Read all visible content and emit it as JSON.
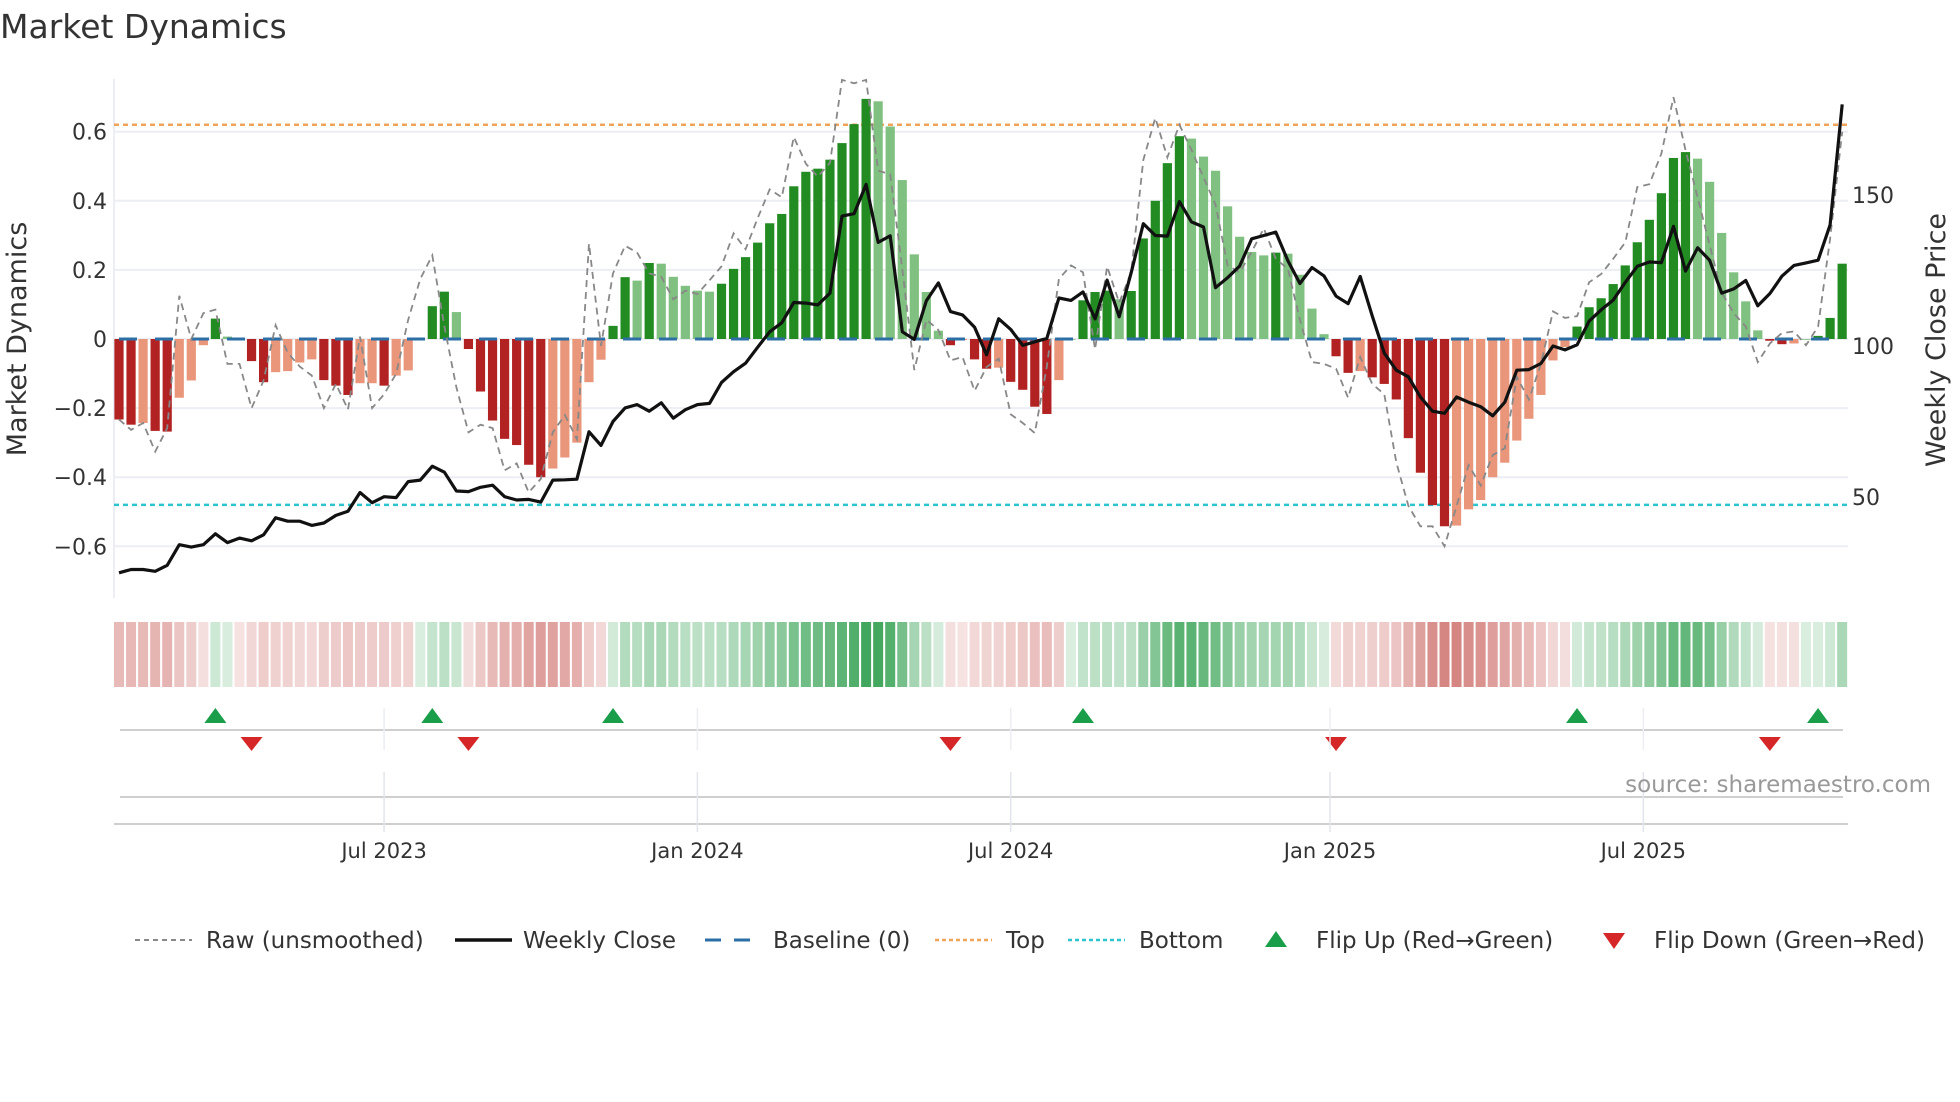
{
  "title": "Market Dynamics",
  "source": "source: sharemaestro.com",
  "colors": {
    "strong_up": "#228b22",
    "weak_up": "#80c080",
    "strong_down": "#b22222",
    "weak_down": "#e9967a",
    "close": "#111111",
    "raw": "#888888",
    "baseline": "#2b6fa6",
    "top": "#f0a45a",
    "bottom": "#2ec4cf",
    "flip_up": "#1a9e4a",
    "flip_down": "#d62728"
  },
  "legend": [
    {
      "label": "Raw (unsmoothed)",
      "kind": "raw"
    },
    {
      "label": "Weekly Close",
      "kind": "close"
    },
    {
      "label": "Baseline (0)",
      "kind": "baseline"
    },
    {
      "label": "Top",
      "kind": "top"
    },
    {
      "label": "Bottom",
      "kind": "bottom"
    },
    {
      "label": "Flip Up (Red→Green)",
      "kind": "flip_up"
    },
    {
      "label": "Flip Down (Green→Red)",
      "kind": "flip_down"
    }
  ],
  "chart_data": {
    "type": "bar",
    "title": "Market Dynamics",
    "ylabel": "Market Dynamics",
    "y2label": "Weekly Close Price",
    "ylim": [
      -0.7,
      0.75
    ],
    "yticks": [
      0.6,
      0.4,
      0.2,
      0,
      -0.2,
      -0.4,
      -0.6
    ],
    "ytick_labels": [
      "0.6",
      "0.4",
      "0.2",
      "0",
      "−0.2",
      "−0.4",
      "−0.6"
    ],
    "y2ticks": [
      150,
      100,
      50
    ],
    "y2tick_labels": [
      "150",
      "100",
      "50"
    ],
    "xtick_labels": [
      "Jul 2023",
      "Jan 2024",
      "Jul 2024",
      "Jan 2025",
      "Jul 2025"
    ],
    "xtick_week_index": [
      22,
      48,
      74,
      100.5,
      126.5
    ],
    "grid": true,
    "legend_position": "bottom",
    "top_level": 0.62,
    "bottom_level": -0.48,
    "baseline": 0,
    "values": [
      -0.233,
      -0.248,
      -0.243,
      -0.266,
      -0.268,
      -0.17,
      -0.12,
      -0.018,
      0.059,
      0.007,
      -0.002,
      -0.064,
      -0.125,
      -0.096,
      -0.093,
      -0.068,
      -0.059,
      -0.119,
      -0.135,
      -0.162,
      -0.128,
      -0.128,
      -0.135,
      -0.106,
      -0.091,
      0,
      0.095,
      0.137,
      0.078,
      -0.029,
      -0.152,
      -0.236,
      -0.289,
      -0.307,
      -0.364,
      -0.4,
      -0.375,
      -0.343,
      -0.3,
      -0.125,
      -0.06,
      0.038,
      0.179,
      0.169,
      0.22,
      0.218,
      0.18,
      0.154,
      0.14,
      0.137,
      0.16,
      0.203,
      0.237,
      0.279,
      0.335,
      0.362,
      0.442,
      0.484,
      0.493,
      0.519,
      0.567,
      0.622,
      0.695,
      0.688,
      0.615,
      0.46,
      0.245,
      0.136,
      0.024,
      -0.018,
      -0.003,
      -0.059,
      -0.086,
      -0.083,
      -0.124,
      -0.147,
      -0.196,
      -0.217,
      -0.119,
      0,
      0.112,
      0.136,
      0.14,
      0.115,
      0.139,
      0.291,
      0.4,
      0.509,
      0.587,
      0.58,
      0.528,
      0.487,
      0.384,
      0.296,
      0.252,
      0.242,
      0.25,
      0.247,
      0.186,
      0.088,
      0.014,
      -0.05,
      -0.098,
      -0.093,
      -0.111,
      -0.13,
      -0.175,
      -0.287,
      -0.387,
      -0.481,
      -0.542,
      -0.54,
      -0.493,
      -0.466,
      -0.4,
      -0.358,
      -0.294,
      -0.231,
      -0.162,
      -0.062,
      -0.023,
      0.036,
      0.092,
      0.118,
      0.159,
      0.213,
      0.28,
      0.345,
      0.422,
      0.524,
      0.541,
      0.522,
      0.455,
      0.307,
      0.193,
      0.109,
      0.025,
      -0.005,
      -0.015,
      -0.013,
      0,
      0.009,
      0.061,
      0.218
    ],
    "strong": [
      1,
      1,
      0,
      1,
      1,
      0,
      0,
      0,
      1,
      0,
      0,
      1,
      1,
      0,
      0,
      0,
      0,
      1,
      1,
      1,
      0,
      0,
      1,
      0,
      0,
      0,
      1,
      1,
      0,
      1,
      1,
      1,
      1,
      1,
      1,
      1,
      0,
      0,
      0,
      0,
      0,
      1,
      1,
      0,
      1,
      0,
      0,
      0,
      0,
      0,
      1,
      1,
      1,
      1,
      1,
      1,
      1,
      1,
      1,
      1,
      1,
      1,
      1,
      0,
      0,
      0,
      0,
      0,
      0,
      1,
      0,
      1,
      1,
      0,
      1,
      1,
      1,
      1,
      0,
      0,
      1,
      1,
      1,
      0,
      1,
      1,
      1,
      1,
      1,
      0,
      0,
      0,
      0,
      0,
      0,
      0,
      1,
      0,
      0,
      0,
      0,
      1,
      1,
      0,
      1,
      1,
      1,
      1,
      1,
      1,
      1,
      0,
      0,
      0,
      0,
      0,
      0,
      0,
      0,
      0,
      0,
      1,
      1,
      1,
      1,
      1,
      1,
      1,
      1,
      1,
      1,
      0,
      0,
      0,
      0,
      0,
      0,
      1,
      1,
      0,
      0,
      1,
      1,
      1
    ],
    "raw": [
      -0.233,
      -0.263,
      -0.243,
      -0.326,
      -0.258,
      0.125,
      0,
      0.075,
      0.085,
      -0.072,
      -0.072,
      -0.2,
      -0.12,
      0.04,
      -0.04,
      -0.08,
      -0.106,
      -0.2,
      -0.13,
      -0.204,
      0.007,
      -0.2,
      -0.16,
      -0.1,
      0.056,
      0.174,
      0.242,
      0.036,
      -0.14,
      -0.27,
      -0.248,
      -0.258,
      -0.38,
      -0.36,
      -0.444,
      -0.405,
      -0.27,
      -0.22,
      -0.29,
      0.276,
      -0.02,
      0.19,
      0.27,
      0.25,
      0.19,
      0.18,
      0.115,
      0.14,
      0.13,
      0.17,
      0.21,
      0.306,
      0.26,
      0.35,
      0.433,
      0.41,
      0.585,
      0.507,
      0.47,
      0.51,
      0.75,
      0.74,
      0.75,
      0.487,
      0.477,
      0.203,
      -0.09,
      0.056,
      0.026,
      -0.062,
      -0.052,
      -0.15,
      -0.081,
      -0.057,
      -0.218,
      -0.243,
      -0.272,
      -0.08,
      0.174,
      0.213,
      0.193,
      -0.03,
      0.21,
      0.105,
      0.193,
      0.518,
      0.64,
      0.526,
      0.62,
      0.547,
      0.468,
      0.389,
      0.213,
      0.193,
      0.252,
      0.32,
      0.232,
      0.203,
      0.056,
      -0.067,
      -0.072,
      -0.086,
      -0.17,
      -0.052,
      -0.13,
      -0.16,
      -0.357,
      -0.483,
      -0.542,
      -0.542,
      -0.6,
      -0.483,
      -0.365,
      -0.424,
      -0.336,
      -0.316,
      -0.11,
      -0.175,
      -0.072,
      0.08,
      0.061,
      0.066,
      0.164,
      0.188,
      0.232,
      0.28,
      0.44,
      0.448,
      0.537,
      0.7,
      0.547,
      0.41,
      0.272,
      0.134,
      0.075,
      0.036,
      -0.067,
      -0.013,
      0.017,
      0.022,
      -0.018,
      0.036,
      0.29,
      0.6
    ],
    "close": [
      24.9,
      26,
      26,
      25.4,
      27.4,
      34.2,
      33.4,
      34.2,
      37.8,
      34.9,
      36.4,
      35.5,
      37.5,
      43.1,
      42,
      42,
      40.6,
      41.4,
      43.9,
      45.3,
      51.5,
      48.1,
      50.1,
      49.8,
      55.1,
      55.6,
      60.2,
      58.2,
      52,
      51.8,
      53.2,
      53.9,
      50.1,
      49,
      49.2,
      48.3,
      55.6,
      55.7,
      55.9,
      71.6,
      67.1,
      75,
      79.5,
      80.6,
      78.4,
      81.2,
      76.1,
      78.9,
      80.6,
      81,
      87.9,
      91.5,
      94.3,
      99.6,
      104.7,
      107.7,
      114.4,
      114.2,
      113.6,
      117.5,
      143,
      143.8,
      153.5,
      134.3,
      136.5,
      104.7,
      102.2,
      115,
      120.9,
      111.4,
      110.3,
      106.2,
      97.1,
      109,
      105.5,
      100.2,
      101.4,
      102.5,
      115.9,
      115.1,
      117.9,
      109,
      121.8,
      109.7,
      124.3,
      140.5,
      136.6,
      136.4,
      147.8,
      141.1,
      139.4,
      119.3,
      122.6,
      126.5,
      135.5,
      136.6,
      137.7,
      128.2,
      120.7,
      126,
      123.2,
      116.5,
      114,
      123,
      110,
      97.6,
      92,
      89.8,
      83.1,
      78.4,
      77.7,
      83.1,
      81.4,
      79.9,
      76.9,
      81.4,
      92,
      92.2,
      94.2,
      100,
      98.7,
      100.4,
      108.2,
      112,
      115.2,
      121.1,
      126.4,
      127.8,
      127.6,
      139.6,
      124.8,
      132.5,
      128.4,
      117.5,
      118.9,
      121.7,
      113.3,
      117.4,
      123.1,
      126.7,
      127.5,
      128.4,
      140.1,
      180
    ],
    "flip_up_index": [
      8,
      26,
      41,
      80,
      121,
      141
    ],
    "flip_down_index": [
      11,
      29,
      69,
      101,
      137
    ]
  }
}
